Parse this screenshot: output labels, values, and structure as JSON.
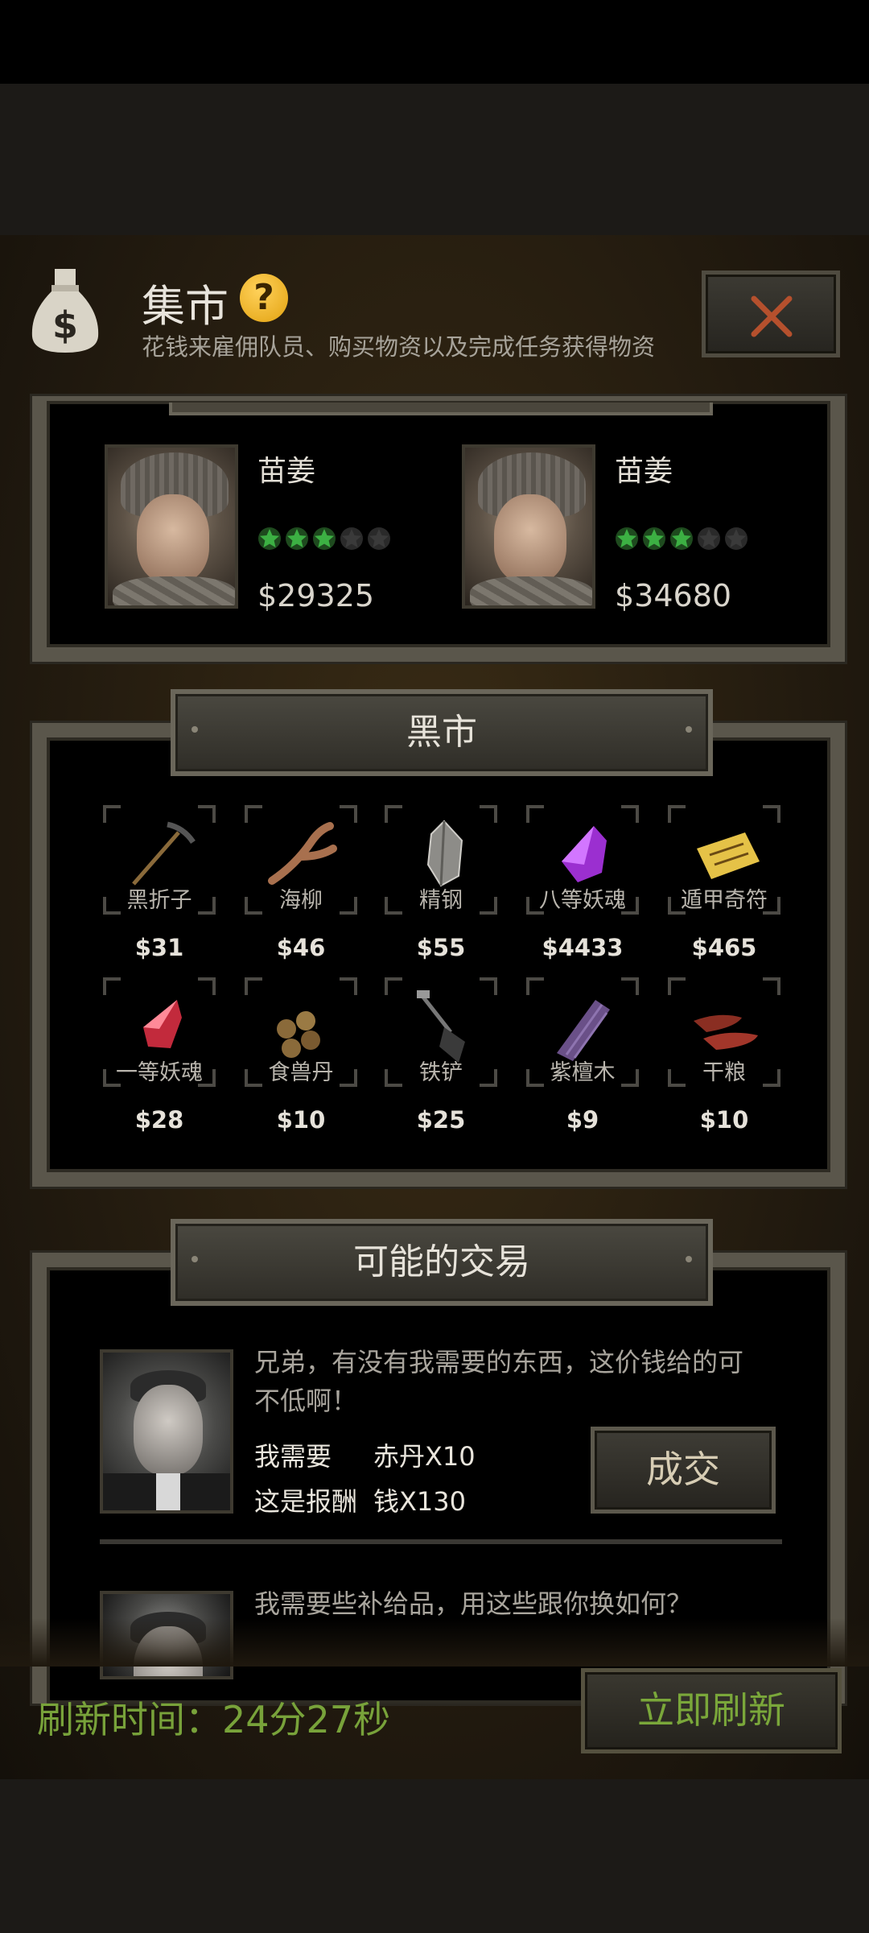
{
  "header": {
    "title": "集市",
    "subtitle": "花钱来雇佣队员、购买物资以及完成任务获得物资",
    "help_glyph": "?"
  },
  "hire": {
    "cards": [
      {
        "name": "苗姜",
        "stars": 3,
        "max_stars": 5,
        "price": "$29325"
      },
      {
        "name": "苗姜",
        "stars": 3,
        "max_stars": 5,
        "price": "$34680"
      }
    ]
  },
  "black_market": {
    "title": "黑市",
    "items": [
      {
        "name": "黑折子",
        "price": "$31",
        "icon": "pickaxe-icon"
      },
      {
        "name": "海柳",
        "price": "$46",
        "icon": "branch-icon"
      },
      {
        "name": "精钢",
        "price": "$55",
        "icon": "ore-icon"
      },
      {
        "name": "八等妖魂",
        "price": "$4433",
        "icon": "purple-crystal-icon"
      },
      {
        "name": "遁甲奇符",
        "price": "$465",
        "icon": "talisman-icon"
      },
      {
        "name": "一等妖魂",
        "price": "$28",
        "icon": "red-crystal-icon"
      },
      {
        "name": "食兽丹",
        "price": "$10",
        "icon": "pills-icon"
      },
      {
        "name": "铁铲",
        "price": "$25",
        "icon": "shovel-icon"
      },
      {
        "name": "紫檀木",
        "price": "$9",
        "icon": "wood-icon"
      },
      {
        "name": "干粮",
        "price": "$10",
        "icon": "jerky-icon"
      }
    ]
  },
  "trades": {
    "title": "可能的交易",
    "entries": [
      {
        "text_line1": "兄弟，有没有我需要的东西，这价钱给的可",
        "text_line2": "不低啊！",
        "need_label": "我需要",
        "need_value": "赤丹X10",
        "reward_label": "这是报酬",
        "reward_value": "钱X130",
        "button": "成交"
      },
      {
        "text_line1": "我需要些补给品，用这些跟你换如何？"
      }
    ]
  },
  "footer": {
    "refresh_time": "刷新时间：24分27秒",
    "refresh_button": "立即刷新"
  },
  "colors": {
    "accent_green": "#78a23a",
    "star_green": "#3cb043",
    "help_yellow": "#f5b91e",
    "close_red": "#b5502d"
  }
}
